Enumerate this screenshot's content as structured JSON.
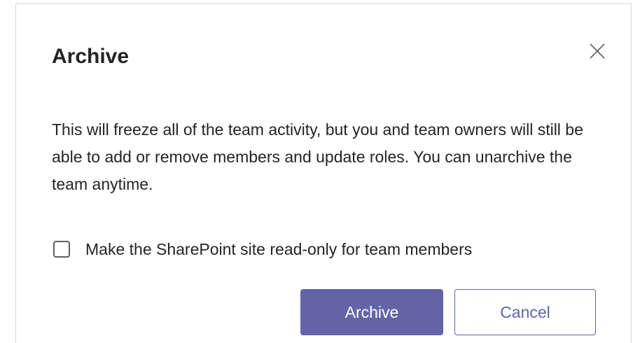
{
  "dialog": {
    "title": "Archive",
    "close_icon": "close-icon",
    "description": "This will freeze all of the team activity, but you and team owners will still be able to add or remove members and update roles. You can unarchive the team anytime.",
    "checkbox": {
      "label": "Make the SharePoint site read-only for team members",
      "checked": false
    },
    "buttons": {
      "primary_label": "Archive",
      "secondary_label": "Cancel"
    }
  },
  "colors": {
    "accent": "#6264a7",
    "text": "#252423"
  }
}
